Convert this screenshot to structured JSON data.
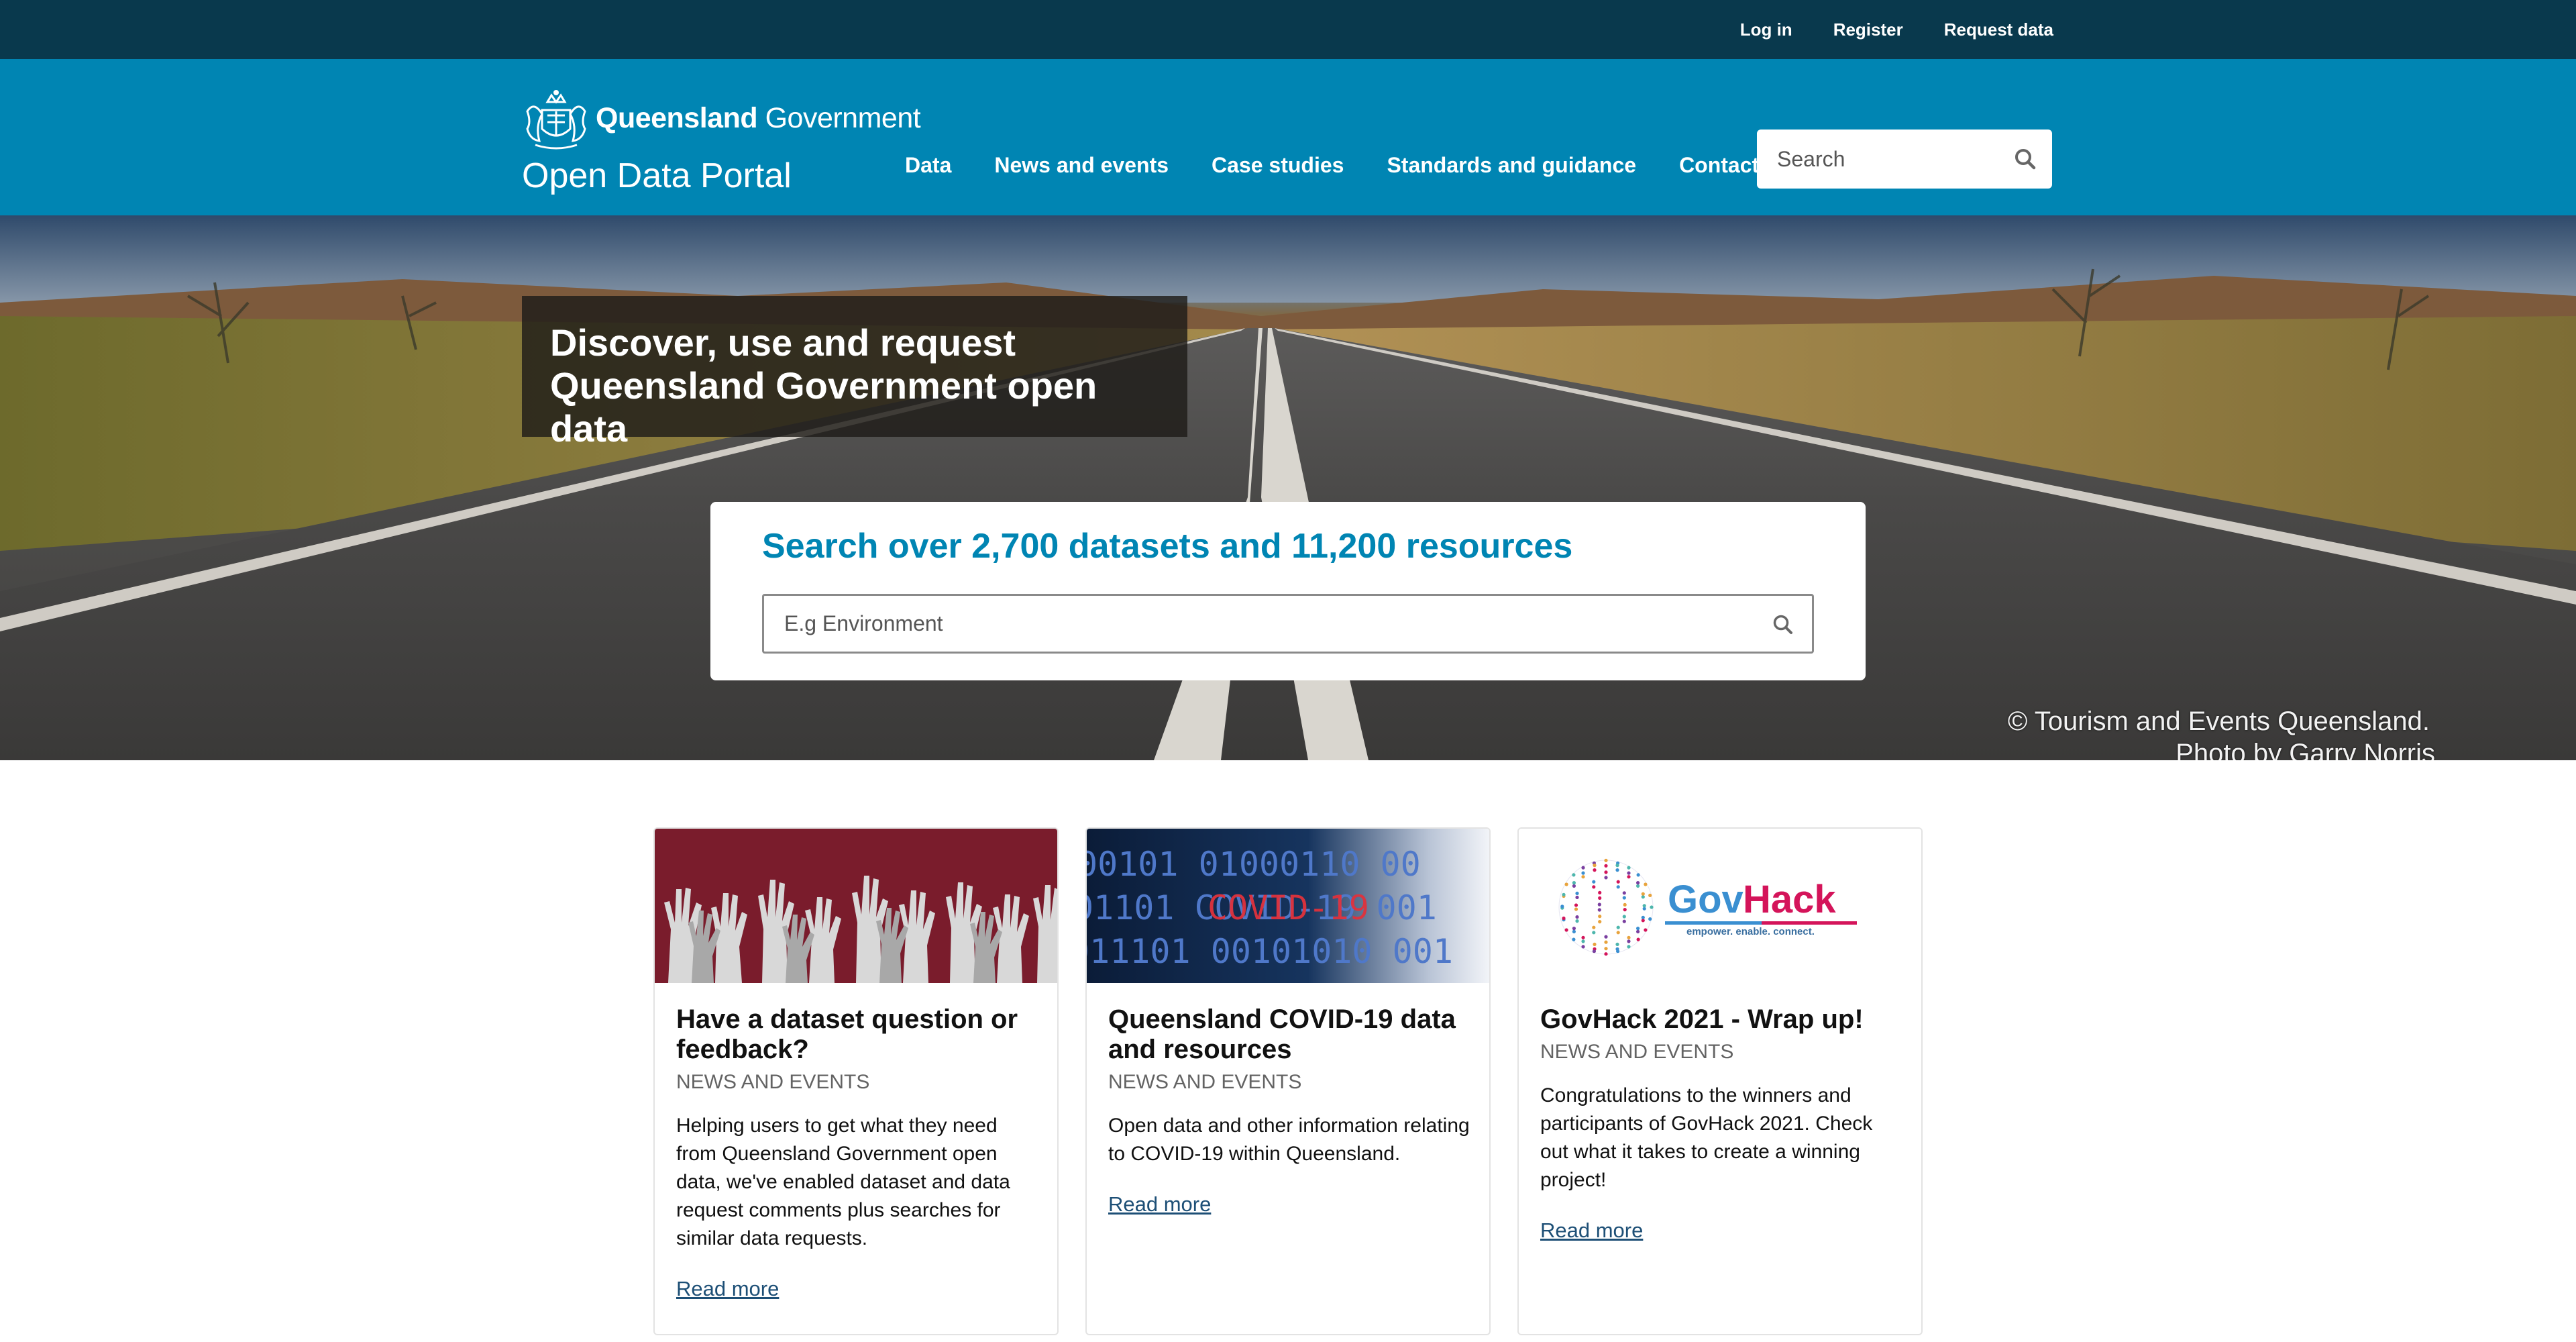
{
  "utility": {
    "login_label": "Log in",
    "register_label": "Register",
    "request_label": "Request data"
  },
  "header": {
    "gov_name_bold": "Queensland",
    "gov_name_regular": "Government",
    "portal_name": "Open Data Portal",
    "nav": [
      {
        "label": "Data"
      },
      {
        "label": "News and events"
      },
      {
        "label": "Case studies"
      },
      {
        "label": "Standards and guidance"
      },
      {
        "label": "Contact"
      }
    ],
    "search_placeholder": "Search"
  },
  "hero": {
    "title_line1": "Discover, use and request",
    "title_line2": "Queensland Government open data",
    "search_heading": "Search over 2,700 datasets and 11,200 resources",
    "search_placeholder": "E.g Environment",
    "credit_line1": "© Tourism and Events Queensland.",
    "credit_line2": "Photo by Garry Norris"
  },
  "cards": [
    {
      "title": "Have a dataset question or feedback?",
      "category": "NEWS AND EVENTS",
      "description": "Helping users to get what they need from Queensland Government open data, we've enabled dataset and data request comments plus searches for similar data requests.",
      "link": "Read more"
    },
    {
      "title": "Queensland COVID-19 data and resources",
      "category": "NEWS AND EVENTS",
      "description": "Open data and other information relating to COVID-19 within Queensland.",
      "link": "Read more",
      "image_text": [
        "00101 01000110 00",
        "01101 COVID-19 001",
        "011101 00101010 001"
      ]
    },
    {
      "title": "GovHack 2021 - Wrap up!",
      "category": "NEWS AND EVENTS",
      "description": "Congratulations to the winners and participants of GovHack 2021. Check out what it takes to create a winning project!",
      "link": "Read more",
      "logo_gov": "Gov",
      "logo_hack": "Hack",
      "logo_tagline": "empower. enable. connect."
    }
  ],
  "colors": {
    "utility_bg": "#09394d",
    "header_bg": "#0085b3",
    "accent": "#0085b3",
    "link": "#1d4f76",
    "card1_bg": "#7a1c2c",
    "card2_bg": "#0c1f3d",
    "govhack_blue": "#3a8fd1",
    "govhack_pink": "#d4145a"
  },
  "icons": {
    "crest": "queensland-crest-icon",
    "search": "search-icon"
  }
}
